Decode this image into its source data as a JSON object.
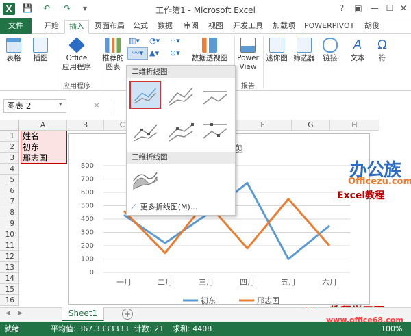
{
  "window": {
    "title": "工作簿1 - Microsoft Excel"
  },
  "tabs": [
    "文件",
    "开始",
    "插入",
    "页面布局",
    "公式",
    "数据",
    "审阅",
    "视图",
    "开发工具",
    "加载项",
    "POWERPIVOT"
  ],
  "user": "胡俊",
  "ribbon": {
    "table": "表格",
    "illustrations": "插图",
    "office_apps_1": "Office",
    "office_apps_2": "应用程序",
    "apps_group": "应用程序",
    "recommended_1": "推荐的",
    "recommended_2": "图表",
    "pivotchart_partial": "数据透视图",
    "power_view_1": "Power",
    "power_view_2": "View",
    "reports_group": "报告",
    "sparkline": "迷你图",
    "filter": "筛选器",
    "link": "链接",
    "text": "文本",
    "symbol": "符"
  },
  "formula_bar": {
    "name_box": "图表 2"
  },
  "columns": [
    "A",
    "B",
    "C",
    "D",
    "E",
    "F",
    "G",
    "H"
  ],
  "rows": [
    "1",
    "2",
    "3",
    "4",
    "5",
    "6",
    "7",
    "8",
    "9",
    "10",
    "11",
    "12",
    "13",
    "14",
    "15",
    "16"
  ],
  "cells": {
    "A1": "姓名",
    "A2": "初东",
    "A3": "邢志国"
  },
  "dropdown": {
    "header_2d": "二维折线图",
    "header_3d": "三维折线图",
    "more": "更多折线图(M)..."
  },
  "chart": {
    "title_partial": "题"
  },
  "chart_data": {
    "type": "line",
    "categories": [
      "一月",
      "二月",
      "三月",
      "四月",
      "五月",
      "六月"
    ],
    "series": [
      {
        "name": "初东",
        "color": "#5b9bd5",
        "values": [
          430,
          220,
          430,
          670,
          100,
          350
        ]
      },
      {
        "name": "邢志国",
        "color": "#ed7d31",
        "values": [
          460,
          145,
          530,
          180,
          550,
          200
        ]
      }
    ],
    "y_ticks": [
      "0",
      "100",
      "200",
      "300",
      "400",
      "500",
      "600",
      "700",
      "800"
    ],
    "ylim": [
      0,
      800
    ],
    "legend": "bottom",
    "grid": true
  },
  "sheet": {
    "tab": "Sheet1"
  },
  "status": {
    "ready": "就绪",
    "average": "平均值: 367.3333333",
    "count": "计数: 21",
    "sum": "求和: 4408",
    "zoom": "100%"
  },
  "watermark": {
    "logo": "办公族",
    "site": "Officezu.com",
    "excel": "Excel教程",
    "bottom_1": "office教程学习网",
    "bottom_2": "www.office68.com"
  },
  "colors": {
    "excel_green": "#217346",
    "accent_orange": "#ed7d31",
    "accent_blue": "#5b9bd5"
  }
}
